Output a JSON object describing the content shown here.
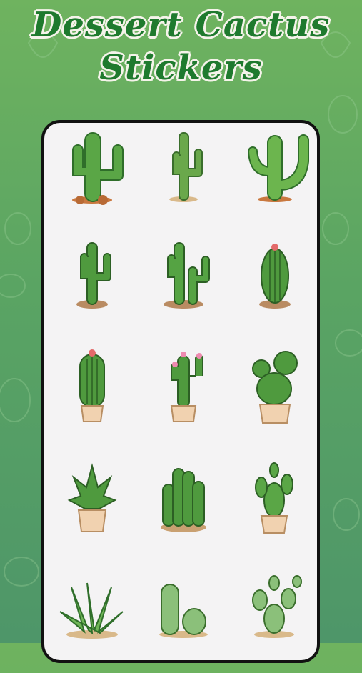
{
  "title": {
    "line1": "Dessert Cactus",
    "line2": "Stickers"
  },
  "colors": {
    "background_top": "#6fb35f",
    "background_bottom": "#4e9669",
    "title_green": "#1f7a2e",
    "title_outline": "#f5f3ea",
    "screen": "#f4f3f4"
  },
  "stickers": [
    {
      "icon": "tall-saguaro-cactus-icon"
    },
    {
      "icon": "thin-saguaro-cactus-icon"
    },
    {
      "icon": "branching-saguaro-cactus-icon"
    },
    {
      "icon": "saguaro-on-soil-icon"
    },
    {
      "icon": "twin-saguaro-on-soil-icon"
    },
    {
      "icon": "barrel-cactus-with-flower-icon"
    },
    {
      "icon": "potted-column-cactus-icon"
    },
    {
      "icon": "potted-flowering-cactus-icon"
    },
    {
      "icon": "potted-round-cactus-icon"
    },
    {
      "icon": "potted-agave-icon"
    },
    {
      "icon": "cluster-cactus-on-soil-icon"
    },
    {
      "icon": "potted-prickly-pear-icon"
    },
    {
      "icon": "aloe-plant-icon"
    },
    {
      "icon": "round-cacti-pair-icon"
    },
    {
      "icon": "prickly-pear-cactus-icon"
    }
  ]
}
